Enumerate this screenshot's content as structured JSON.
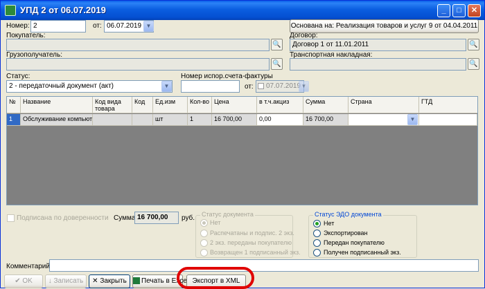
{
  "window": {
    "title": "УПД 2 от 06.07.2019",
    "controls": {
      "minimize": "_",
      "maximize": "□",
      "close": "✕"
    }
  },
  "header": {
    "number_label": "Номер:",
    "number_value": "2",
    "date_label": "от:",
    "date_value": "06.07.2019",
    "based_on_button": "Основана на: Реализация товаров и услуг 9 от 04.04.2011"
  },
  "parties": {
    "buyer_label": "Покупатель:",
    "buyer_value": "",
    "contract_label": "Договор:",
    "contract_value": "Договор 1 от 11.01.2011",
    "consignee_label": "Грузополучатель:",
    "consignee_value": "",
    "waybill_label": "Транспортная накладная:",
    "waybill_value": ""
  },
  "status": {
    "label": "Статус:",
    "value": "2 - передаточный документ (акт)",
    "corr_invoice_label": "Номер испор.счета-фактуры",
    "corr_invoice_value": "",
    "corr_date_label": "от:",
    "corr_date_value": "07.07.2019"
  },
  "table": {
    "headers": [
      "№",
      "Название",
      "Код вида товара",
      "Код",
      "Ед.изм",
      "Кол-во",
      "Цена",
      "в т.ч.акциз",
      "Сумма",
      "Страна",
      "ГТД"
    ],
    "rows": [
      [
        "1",
        "Обслуживание компьют…",
        "",
        "",
        "шт",
        "1",
        "16 700,00",
        "0,00",
        "16 700,00",
        "",
        ""
      ]
    ]
  },
  "summary": {
    "signed_by_proxy": "Подписана по доверенности",
    "sum_label": "Сумма:",
    "sum_value": "16 700,00",
    "currency": "руб."
  },
  "doc_status": {
    "title": "Статус документа",
    "options": [
      "Нет",
      "Распечатаны и подпис. 2 экз.",
      "2 экз. переданы покупателю",
      "Возвращен 1 подписанный экз."
    ]
  },
  "edo_status": {
    "title": "Статус ЭДО документа",
    "options": [
      "Нет",
      "Экспортирован",
      "Передан покупателю",
      "Получен подписанный экз."
    ]
  },
  "comment": {
    "label": "Комментарий:",
    "value": ""
  },
  "footer": {
    "ok": "OK",
    "save": "Записать",
    "close": "Закрыть",
    "print_excel": "Печать в Excel",
    "export_xml": "Экспорт в XML"
  },
  "colors": {
    "title_blue": "#0450d2",
    "selection": "#316ac5",
    "highlight": "#e00000"
  }
}
